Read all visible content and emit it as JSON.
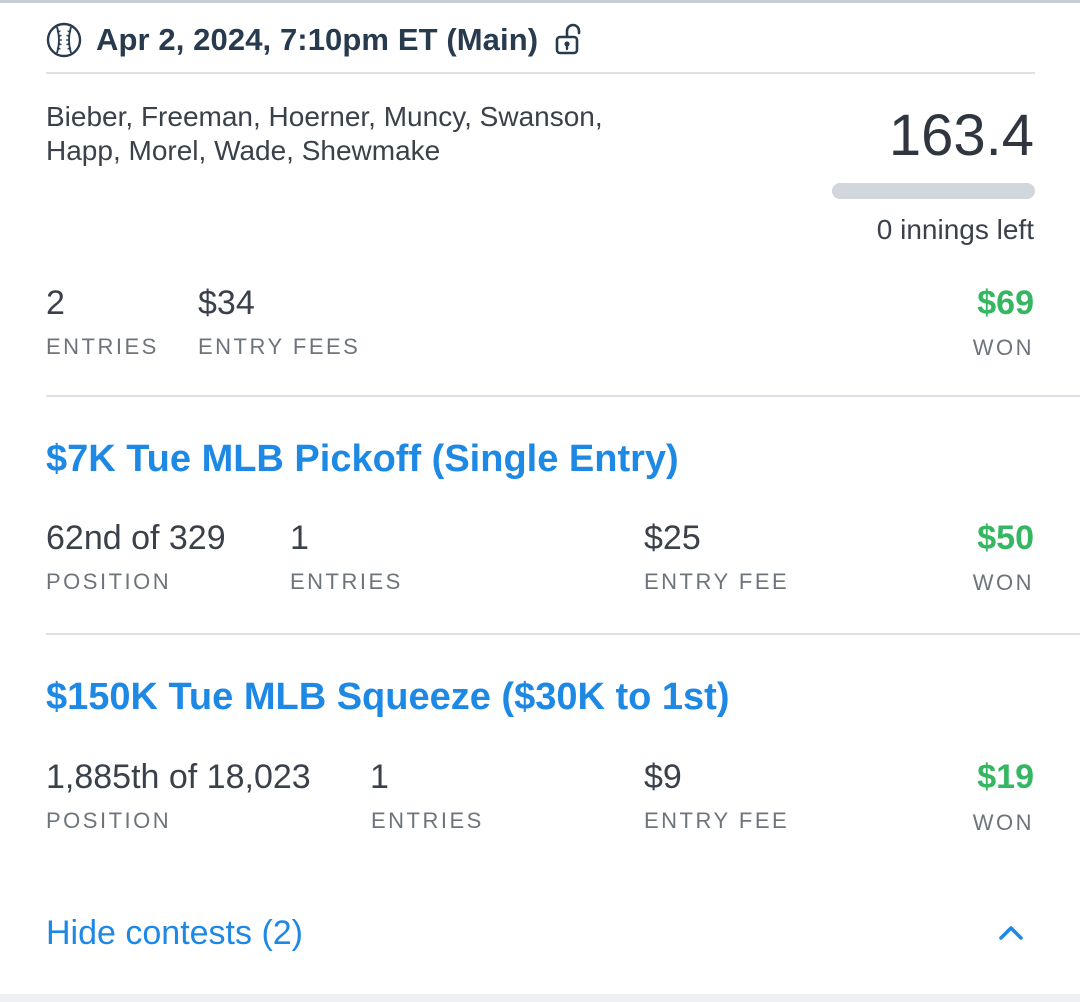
{
  "header": {
    "title": "Apr 2, 2024, 7:10pm ET (Main)",
    "ball_icon": "baseball-icon",
    "lock_icon": "unlocked-icon"
  },
  "summary": {
    "lineup_line1": "Bieber, Freeman, Hoerner, Muncy, Swanson,",
    "lineup_line2": "Happ, Morel, Wade, Shewmake",
    "score": "163.4",
    "innings_left": "0 innings left",
    "innings_progress_fraction": 0,
    "entries_value": "2",
    "entries_label": "ENTRIES",
    "entry_fees_value": "$34",
    "entry_fees_label": "ENTRY FEES",
    "won_value": "$69",
    "won_label": "WON"
  },
  "contests": [
    {
      "name": "$7K Tue MLB Pickoff (Single Entry)",
      "position_value": "62nd of 329",
      "position_label": "POSITION",
      "entries_value": "1",
      "entries_label": "ENTRIES",
      "fee_value": "$25",
      "fee_label": "ENTRY FEE",
      "won_value": "$50",
      "won_label": "WON"
    },
    {
      "name": "$150K Tue MLB Squeeze ($30K to 1st)",
      "position_value": "1,885th of 18,023",
      "position_label": "POSITION",
      "entries_value": "1",
      "entries_label": "ENTRIES",
      "fee_value": "$9",
      "fee_label": "ENTRY FEE",
      "won_value": "$19",
      "won_label": "WON"
    }
  ],
  "footer": {
    "hide_label": "Hide contests (2)",
    "chevron_icon": "chevron-up-icon"
  },
  "colors": {
    "accent": "#1e88e5",
    "won": "#35b661",
    "title": "#283a4e"
  }
}
